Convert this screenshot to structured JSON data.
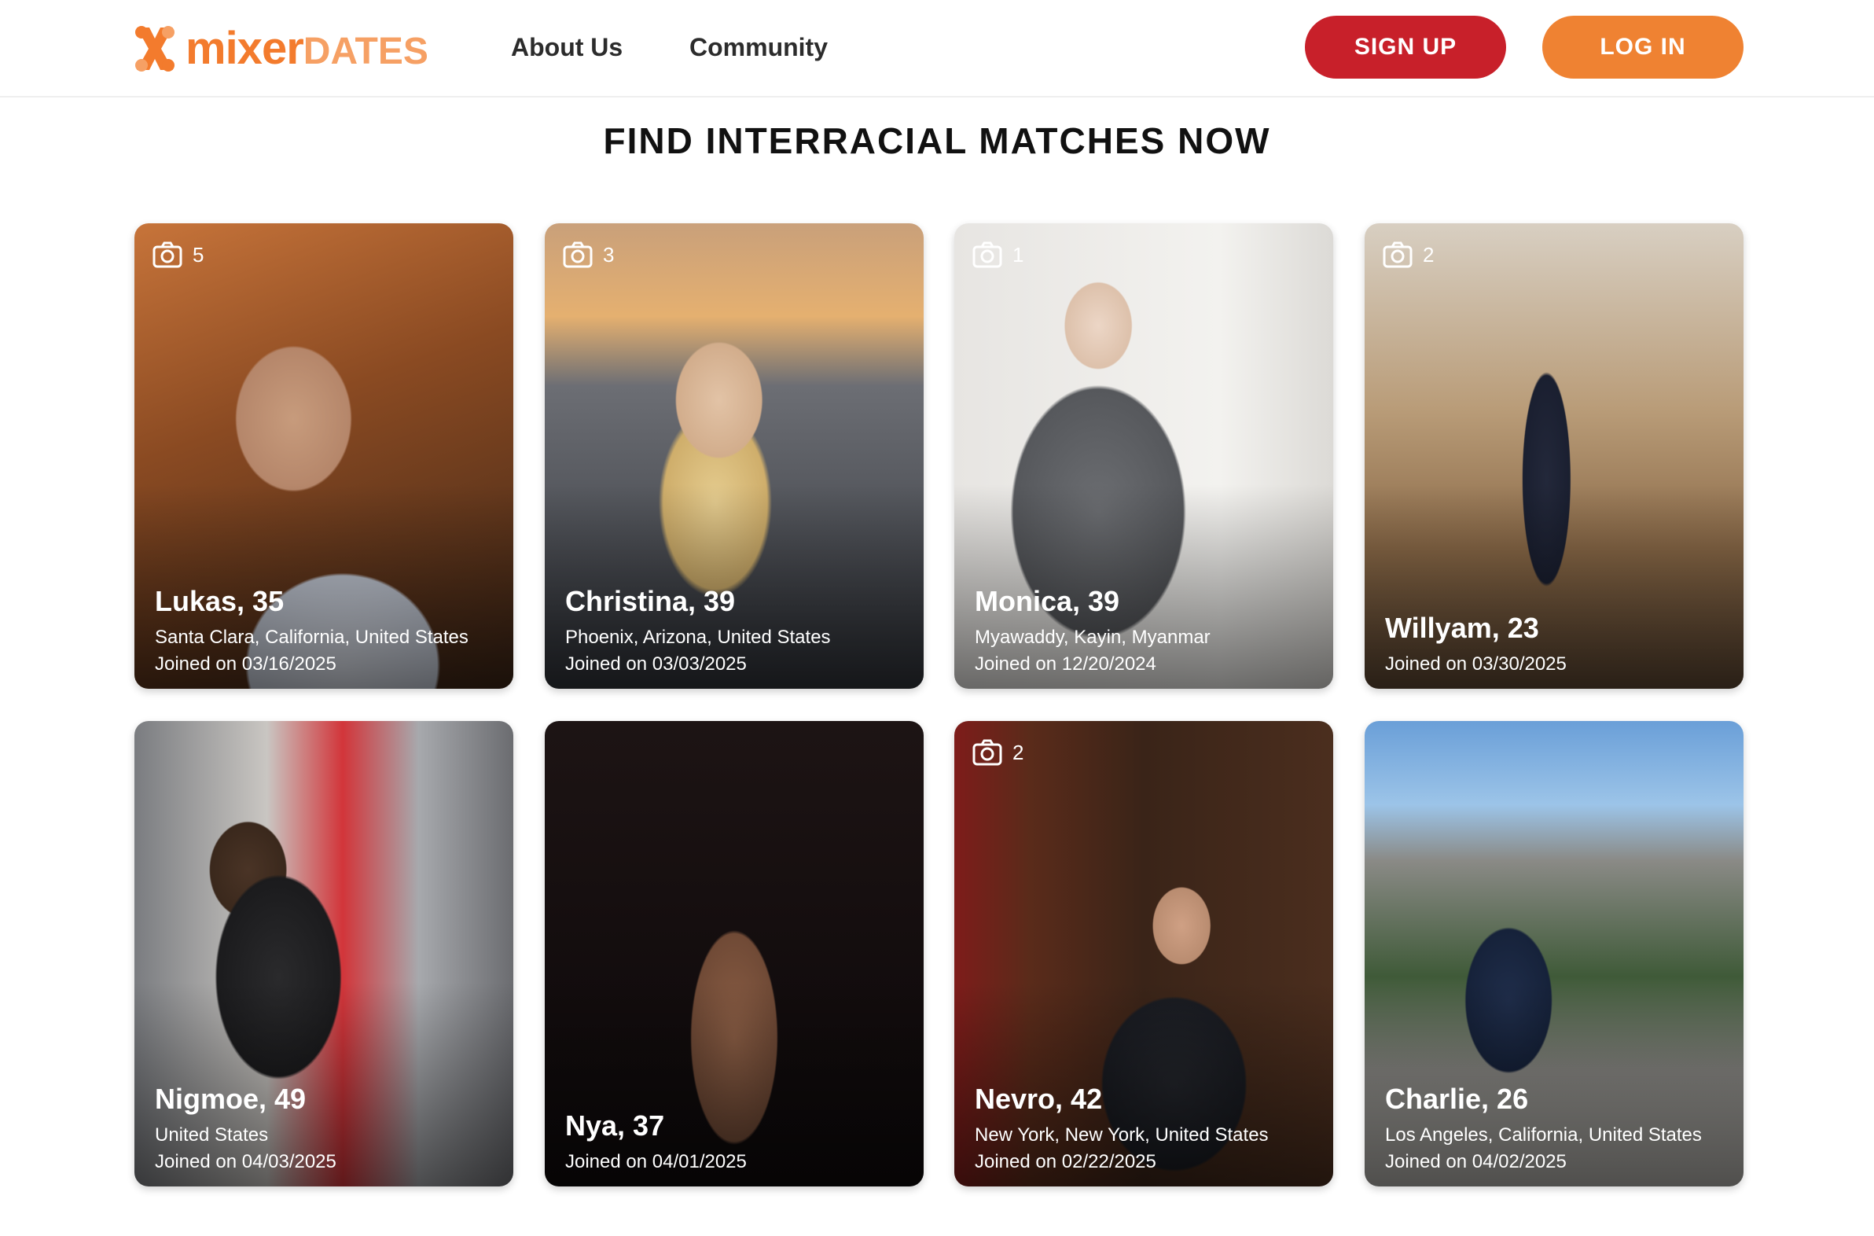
{
  "brand": {
    "name_part1": "mixer",
    "name_part2": "DATES",
    "accent_color": "#f37b2d",
    "secondary_color": "#f6a064"
  },
  "nav": {
    "links": [
      "About Us",
      "Community"
    ],
    "signup_label": "SIGN UP",
    "login_label": "LOG IN",
    "signup_color": "#c8202a",
    "login_color": "#ef8232"
  },
  "page_title": "FIND INTERRACIAL MATCHES NOW",
  "profiles": [
    {
      "name": "Lukas, 35",
      "location": "Santa Clara, California, United States",
      "joined": "Joined on 03/16/2025",
      "photos": "5"
    },
    {
      "name": "Christina, 39",
      "location": "Phoenix, Arizona, United States",
      "joined": "Joined on 03/03/2025",
      "photos": "3"
    },
    {
      "name": "Monica, 39",
      "location": "Myawaddy, Kayin, Myanmar",
      "joined": "Joined on 12/20/2024",
      "photos": "1"
    },
    {
      "name": "Willyam, 23",
      "location": "",
      "joined": "Joined on 03/30/2025",
      "photos": "2"
    },
    {
      "name": "Nigmoe, 49",
      "location": "United States",
      "joined": "Joined on 04/03/2025",
      "photos": ""
    },
    {
      "name": "Nya, 37",
      "location": "",
      "joined": "Joined on 04/01/2025",
      "photos": ""
    },
    {
      "name": "Nevro, 42",
      "location": "New York, New York, United States",
      "joined": "Joined on 02/22/2025",
      "photos": "2"
    },
    {
      "name": "Charlie, 26",
      "location": "Los Angeles, California, United States",
      "joined": "Joined on 04/02/2025",
      "photos": ""
    }
  ],
  "icons": {
    "logo": "x-logo-icon",
    "photo_count": "camera-icon"
  }
}
